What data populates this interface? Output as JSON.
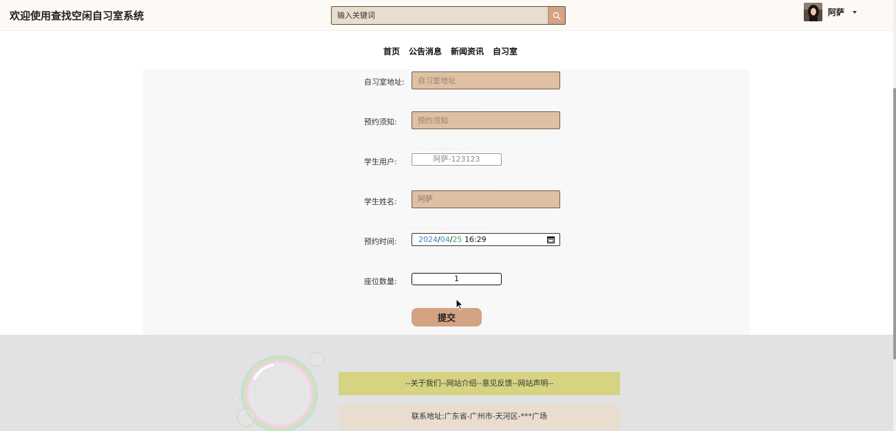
{
  "header": {
    "site_title": "欢迎使用查找空闲自习室系统",
    "search_placeholder": "输入关键词",
    "user_name": "阿萨"
  },
  "nav": {
    "items": [
      "首页",
      "公告消息",
      "新闻资讯",
      "自习室"
    ]
  },
  "form": {
    "address": {
      "label": "自习室地址:",
      "placeholder": "自习室地址"
    },
    "notice": {
      "label": "预约须知:",
      "placeholder": "预约须知"
    },
    "student_user": {
      "label": "学生用户:",
      "value": "阿萨-123123"
    },
    "student_name": {
      "label": "学生姓名:",
      "value": "阿萨"
    },
    "reserve_time": {
      "label": "预约时间:",
      "year": "2024",
      "month": "04",
      "day": "25",
      "time": "16:29"
    },
    "seat_count": {
      "label": "座位数量:",
      "value": "1"
    },
    "submit_label": "提交"
  },
  "footer": {
    "links_text": "--关于我们--网站介绍--意见反馈--网站声明--",
    "address_text": "联系地址:广东省-广州市-天河区-***广场"
  },
  "colors": {
    "accent": "#d4a383",
    "field_bg": "#dfc0a4",
    "footer_links_bg": "#d6d482",
    "footer_addr_bg": "#e9ddd0"
  },
  "icons": {
    "search": "search-icon",
    "calendar": "calendar-icon",
    "caret": "caret-down-icon"
  }
}
